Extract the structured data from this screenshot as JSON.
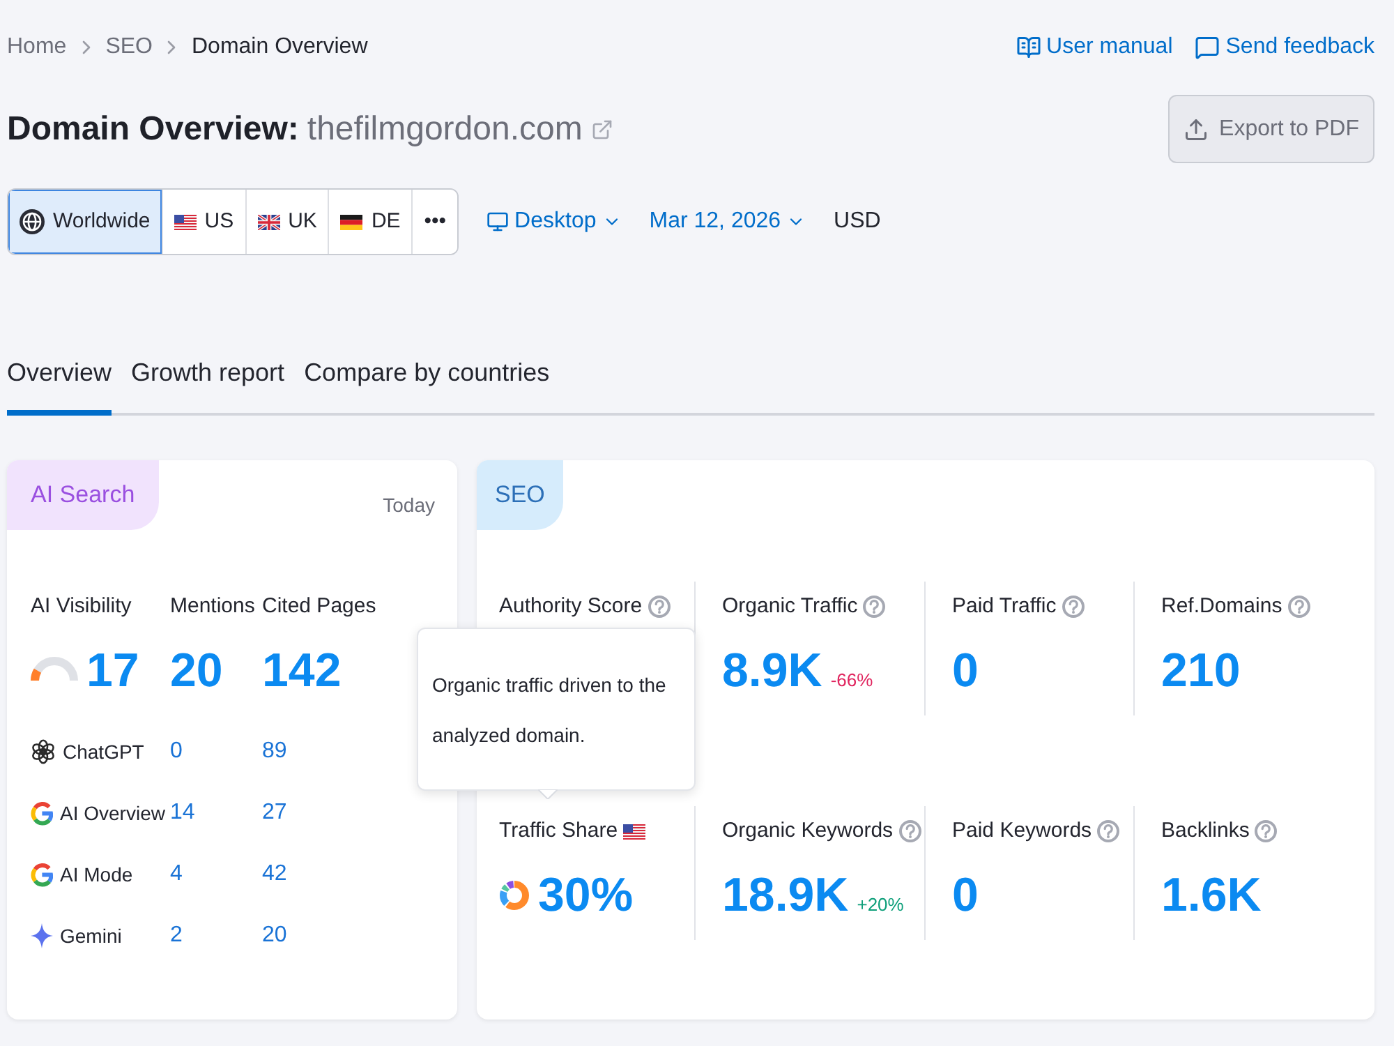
{
  "breadcrumb": [
    {
      "label": "Home",
      "current": false
    },
    {
      "label": "SEO",
      "current": false
    },
    {
      "label": "Domain Overview",
      "current": true
    }
  ],
  "header_links": [
    {
      "label": "User manual"
    },
    {
      "label": "Send feedback"
    }
  ],
  "title": {
    "prefix": "Domain Overview:",
    "domain": "thefilmgordon.com"
  },
  "export_button": "Export to PDF",
  "regions": [
    {
      "label": "Worldwide",
      "selected": true
    },
    {
      "label": "US",
      "selected": false
    },
    {
      "label": "UK",
      "selected": false
    },
    {
      "label": "DE",
      "selected": false
    },
    {
      "label": "•••",
      "selected": false
    }
  ],
  "device": "Desktop",
  "date": "Mar 12, 2026",
  "currency": "USD",
  "tabs": [
    {
      "label": "Overview",
      "selected": true
    },
    {
      "label": "Growth report",
      "selected": false
    },
    {
      "label": "Compare by countries",
      "selected": false
    }
  ],
  "ai_search": {
    "tag": "AI Search",
    "period": "Today",
    "metrics": [
      {
        "label": "AI Visibility",
        "value": "17",
        "level": 0.17
      },
      {
        "label": "Mentions",
        "value": "20"
      },
      {
        "label": "Cited Pages",
        "value": "142"
      }
    ],
    "platforms": [
      {
        "name": "ChatGPT",
        "mentions": "0",
        "cited_pages": "89"
      },
      {
        "name": "AI Overview",
        "mentions": "14",
        "cited_pages": "27"
      },
      {
        "name": "AI Mode",
        "mentions": "4",
        "cited_pages": "42"
      },
      {
        "name": "Gemini",
        "mentions": "2",
        "cited_pages": "20"
      }
    ]
  },
  "seo": {
    "tag": "SEO",
    "metrics": [
      {
        "kind": "metric",
        "label": "Authority Score"
      },
      {
        "kind": "metric",
        "label": "Organic Traffic",
        "value": "8.9K",
        "change": {
          "text": "-66%",
          "color": "#e0245e"
        }
      },
      {
        "kind": "metric",
        "label": "Paid Traffic",
        "value": "0"
      },
      {
        "kind": "metric",
        "label": "Ref.Domains",
        "value": "210"
      },
      {
        "kind": "share",
        "label": "Traffic Share",
        "value": "30%"
      },
      {
        "kind": "metric",
        "label": "Organic Keywords",
        "value": "18.9K",
        "change": {
          "text": "+20%",
          "color": "#0e9f7a"
        }
      },
      {
        "kind": "metric",
        "label": "Paid Keywords",
        "value": "0"
      },
      {
        "kind": "metric",
        "label": "Backlinks",
        "value": "1.6K"
      }
    ],
    "tooltip": {
      "text": "Organic traffic driven to the analyzed domain."
    }
  }
}
